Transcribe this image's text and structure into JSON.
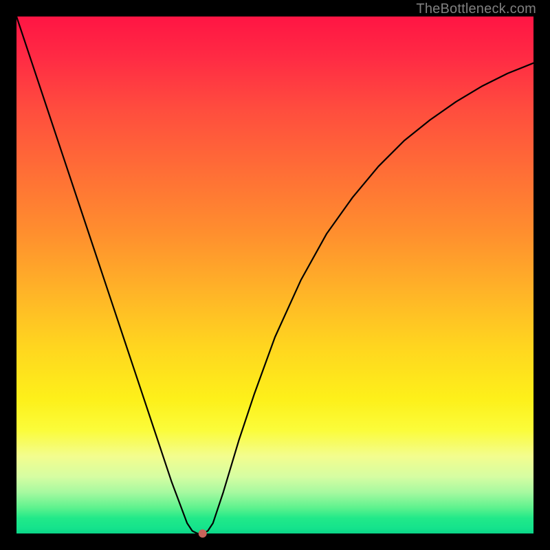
{
  "watermark": "TheBottleneck.com",
  "chart_data": {
    "type": "line",
    "title": "",
    "xlabel": "",
    "ylabel": "",
    "xlim": [
      0,
      100
    ],
    "ylim": [
      0,
      100
    ],
    "x": [
      0,
      3,
      6,
      9,
      12,
      15,
      18,
      21,
      24,
      27,
      30,
      33,
      34,
      35,
      36,
      37,
      38,
      40,
      43,
      46,
      50,
      55,
      60,
      65,
      70,
      75,
      80,
      85,
      90,
      95,
      100
    ],
    "y": [
      100,
      91,
      82,
      73,
      64,
      55,
      46,
      37,
      28,
      19,
      10,
      2,
      0.5,
      0,
      0,
      0.5,
      2,
      8,
      18,
      27,
      38,
      49,
      58,
      65,
      71,
      76,
      80,
      83.5,
      86.5,
      89,
      91
    ],
    "marker": {
      "x": 36,
      "y": 0,
      "color": "#c9635a",
      "radius_px": 6
    },
    "colors": {
      "curve": "#000000",
      "gradient_top": "#ff1544",
      "gradient_mid": "#ffd61f",
      "gradient_bottom": "#14e38c",
      "frame": "#000000"
    }
  }
}
